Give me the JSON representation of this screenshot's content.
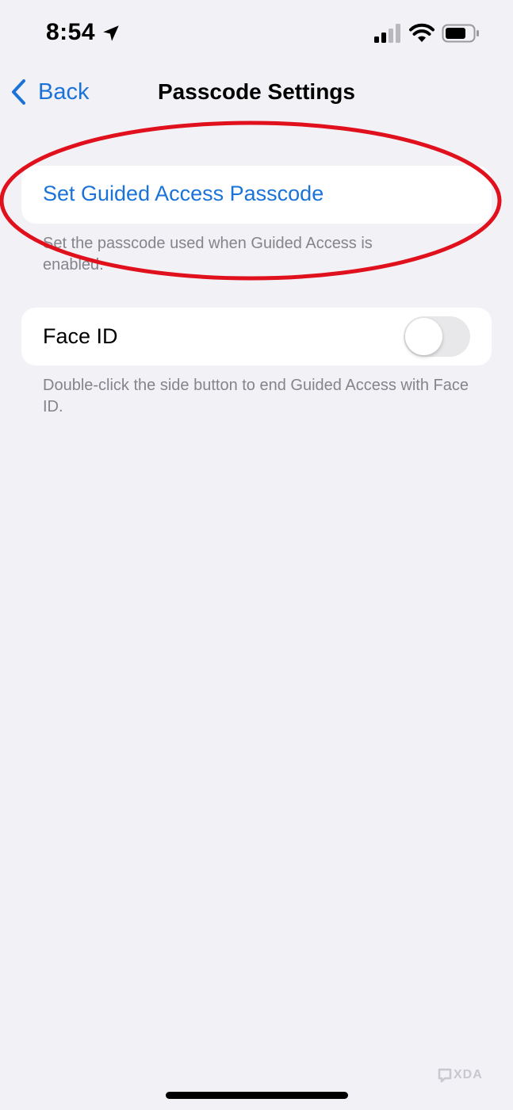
{
  "status_bar": {
    "time": "8:54",
    "icons": [
      "location-arrow-icon",
      "cellular-signal-icon",
      "wifi-icon",
      "battery-icon"
    ]
  },
  "nav": {
    "back_label": "Back",
    "title": "Passcode Settings"
  },
  "section_passcode": {
    "link_label": "Set Guided Access Passcode",
    "footer": "Set the passcode used when Guided Access is enabled."
  },
  "section_face_id": {
    "label": "Face ID",
    "toggle_on": false,
    "footer": "Double-click the side button to end Guided Access with Face ID."
  },
  "watermark": {
    "text": "XDA"
  },
  "colors": {
    "background": "#f2f1f6",
    "accent": "#1a73d9",
    "highlight": "#e0101c",
    "footer_text": "#85848a"
  }
}
